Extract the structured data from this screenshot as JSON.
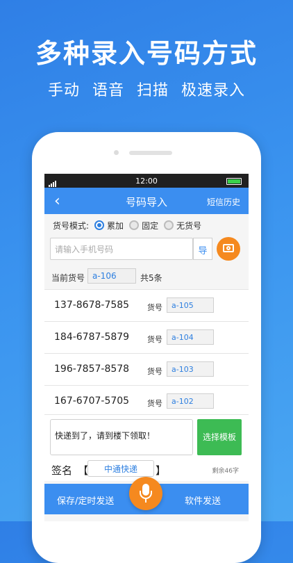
{
  "promo": {
    "title": "多种录入号码方式",
    "subtitle": "手动 语音 扫描 极速录入"
  },
  "status_bar": {
    "time": "12:00"
  },
  "nav": {
    "title": "号码导入",
    "right_action": "短信历史"
  },
  "mode": {
    "label": "货号模式:",
    "options": [
      "累加",
      "固定",
      "无货号"
    ],
    "selected": "累加"
  },
  "phone_input": {
    "placeholder": "请输入手机号码",
    "import_label": "导"
  },
  "current": {
    "label": "当前货号",
    "code": "a-106",
    "total": "共5条"
  },
  "list": [
    {
      "phone": "137-8678-7585",
      "code_label": "货号",
      "code": "a-105"
    },
    {
      "phone": "184-6787-5879",
      "code_label": "货号",
      "code": "a-104"
    },
    {
      "phone": "196-7857-8578",
      "code_label": "货号",
      "code": "a-103"
    },
    {
      "phone": "167-6707-5705",
      "code_label": "货号",
      "code": "a-102"
    }
  ],
  "compose": {
    "message": "快递到了，请到楼下领取！",
    "template_button": "选择模板"
  },
  "signature": {
    "label": "签名",
    "open": "【",
    "close": "】",
    "value": "中通快递",
    "remaining": "剩余46字"
  },
  "bottom_bar": {
    "save_label": "保存/定时发送",
    "send_label": "软件发送"
  },
  "colors": {
    "primary": "#3b8ef0",
    "accent": "#f5891f",
    "green": "#3dbb54"
  },
  "icons": {
    "back": "back-arrow-icon",
    "camera": "camera-icon",
    "mic": "microphone-icon"
  }
}
